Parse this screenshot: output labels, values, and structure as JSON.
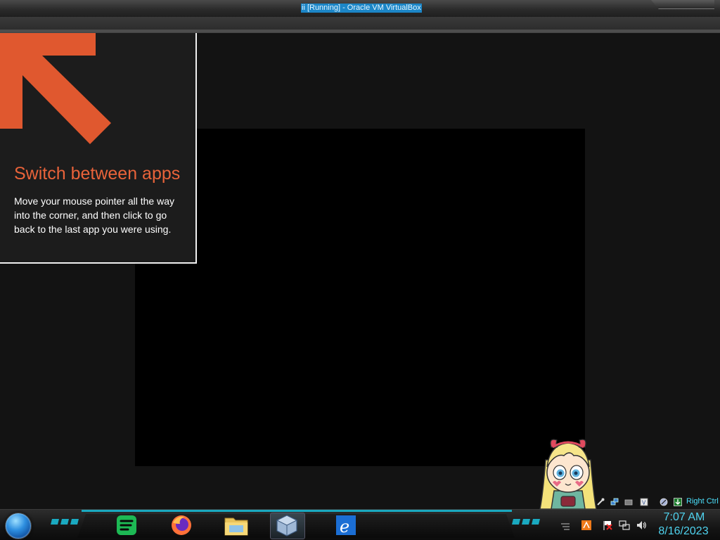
{
  "window": {
    "title": "ii [Running] - Oracle VM VirtualBox"
  },
  "tip": {
    "title": "Switch between apps",
    "body": "Move your mouse pointer all the way into the corner, and then click to go back to the last app you were using.",
    "accent_color": "#e0582f"
  },
  "statusbar": {
    "icons": [
      "usb-icon",
      "network-icon",
      "shared-folders-icon",
      "display-icon",
      "mouse-integration-icon",
      "capture-arrow-icon"
    ],
    "host_key": "Right Ctrl"
  },
  "taskbar": {
    "start": "start-orb",
    "apps": [
      {
        "name": "spotify",
        "icon": "spotify-icon"
      },
      {
        "name": "firefox",
        "icon": "firefox-icon"
      },
      {
        "name": "file-explorer",
        "icon": "folder-icon"
      },
      {
        "name": "virtualbox",
        "icon": "virtualbox-icon",
        "active": true
      },
      {
        "name": "internet-explorer",
        "icon": "ie-icon"
      }
    ],
    "tray_icons": [
      "flag-icon",
      "action-center-icon",
      "network-icon",
      "volume-icon",
      "show-hidden-icon"
    ],
    "clock_time": "7:07 AM",
    "clock_date": "8/16/2023",
    "accent_color": "#1aa9c0"
  }
}
